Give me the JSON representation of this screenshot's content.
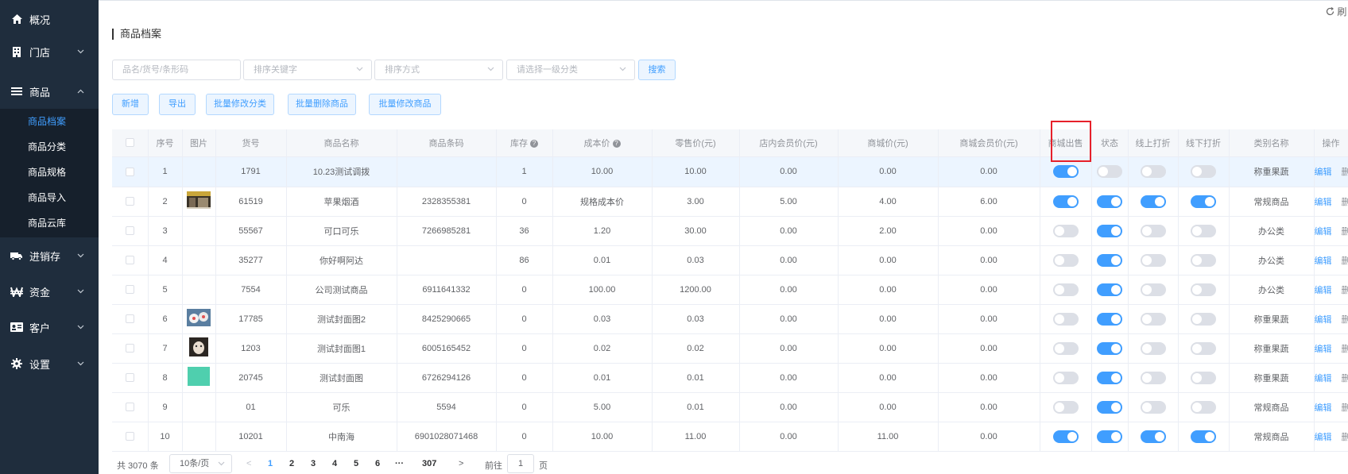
{
  "sidebar": {
    "items": [
      {
        "label": "概况",
        "icon": "home-icon"
      },
      {
        "label": "门店",
        "icon": "store-icon"
      },
      {
        "label": "商品",
        "icon": "list-icon"
      },
      {
        "label": "进销存",
        "icon": "truck-icon"
      },
      {
        "label": "资金",
        "icon": "currency-icon"
      },
      {
        "label": "客户",
        "icon": "id-card-icon"
      },
      {
        "label": "设置",
        "icon": "gear-icon"
      }
    ],
    "sub_items": [
      "商品档案",
      "商品分类",
      "商品规格",
      "商品导入",
      "商品云库"
    ]
  },
  "header": {
    "refresh_label": "刷"
  },
  "page_title": "商品档案",
  "filters": {
    "keyword_placeholder": "品名/货号/条形码",
    "sort_key_placeholder": "排序关键字",
    "sort_order_placeholder": "排序方式",
    "category_placeholder": "请选择一级分类",
    "search_label": "搜索"
  },
  "toolbar": {
    "add": "新增",
    "export": "导出",
    "batch_category": "批量修改分类",
    "batch_delete": "批量删除商品",
    "batch_edit": "批量修改商品"
  },
  "table": {
    "headers": {
      "index": "序号",
      "image": "图片",
      "code": "货号",
      "name": "商品名称",
      "barcode": "商品条码",
      "stock": "库存",
      "cost": "成本价",
      "retail": "零售价(元)",
      "member": "店内会员价(元)",
      "mall": "商城价(元)",
      "mall_member": "商城会员价(元)",
      "mall_sale": "商城出售",
      "status": "状态",
      "online_discount": "线上打折",
      "offline_discount": "线下打折",
      "category": "类别名称",
      "ops": "操作"
    },
    "help_glyph": "?",
    "edit_label": "编辑",
    "delete_label": "删除",
    "rows": [
      {
        "index": "1",
        "image": "",
        "code": "1791",
        "name": "10.23测试调拨",
        "barcode": "",
        "stock": "1",
        "cost": "10.00",
        "retail": "10.00",
        "member": "0.00",
        "mall": "0.00",
        "mall_member": "0.00",
        "mall_sale": true,
        "status": false,
        "online_discount": false,
        "offline_discount": false,
        "category": "称重果蔬"
      },
      {
        "index": "2",
        "image": "storefront-thumbnail",
        "code": "61519",
        "name": "苹果烟酒",
        "barcode": "2328355381",
        "stock": "0",
        "cost": "规格成本价",
        "retail": "3.00",
        "member": "5.00",
        "mall": "4.00",
        "mall_member": "6.00",
        "mall_sale": true,
        "status": true,
        "online_discount": true,
        "offline_discount": true,
        "category": "常规商品"
      },
      {
        "index": "3",
        "image": "",
        "code": "55567",
        "name": "可口可乐",
        "barcode": "7266985281",
        "stock": "36",
        "cost": "1.20",
        "retail": "30.00",
        "member": "0.00",
        "mall": "2.00",
        "mall_member": "0.00",
        "mall_sale": false,
        "status": true,
        "online_discount": false,
        "offline_discount": false,
        "category": "办公类"
      },
      {
        "index": "4",
        "image": "",
        "code": "35277",
        "name": "你好啊阿达",
        "barcode": "",
        "stock": "86",
        "cost": "0.01",
        "retail": "0.03",
        "member": "0.00",
        "mall": "0.00",
        "mall_member": "0.00",
        "mall_sale": false,
        "status": true,
        "online_discount": false,
        "offline_discount": false,
        "category": "办公类"
      },
      {
        "index": "5",
        "image": "",
        "code": "7554",
        "name": "公司测试商品",
        "barcode": "6911641332",
        "stock": "0",
        "cost": "100.00",
        "retail": "1200.00",
        "member": "0.00",
        "mall": "0.00",
        "mall_member": "0.00",
        "mall_sale": false,
        "status": true,
        "online_discount": false,
        "offline_discount": false,
        "category": "办公类"
      },
      {
        "index": "6",
        "image": "eggs-thumbnail",
        "code": "17785",
        "name": "测试封面图2",
        "barcode": "8425290665",
        "stock": "0",
        "cost": "0.03",
        "retail": "0.03",
        "member": "0.00",
        "mall": "0.00",
        "mall_member": "0.00",
        "mall_sale": false,
        "status": true,
        "online_discount": false,
        "offline_discount": false,
        "category": "称重果蔬"
      },
      {
        "index": "7",
        "image": "pet-thumbnail",
        "code": "1203",
        "name": "测试封面图1",
        "barcode": "6005165452",
        "stock": "0",
        "cost": "0.02",
        "retail": "0.02",
        "member": "0.00",
        "mall": "0.00",
        "mall_member": "0.00",
        "mall_sale": false,
        "status": true,
        "online_discount": false,
        "offline_discount": false,
        "category": "称重果蔬"
      },
      {
        "index": "8",
        "image": "teal-thumbnail",
        "code": "20745",
        "name": "测试封面图",
        "barcode": "6726294126",
        "stock": "0",
        "cost": "0.01",
        "retail": "0.01",
        "member": "0.00",
        "mall": "0.00",
        "mall_member": "0.00",
        "mall_sale": false,
        "status": true,
        "online_discount": false,
        "offline_discount": false,
        "category": "称重果蔬"
      },
      {
        "index": "9",
        "image": "",
        "code": "01",
        "name": "可乐",
        "barcode": "5594",
        "stock": "0",
        "cost": "5.00",
        "retail": "0.01",
        "member": "0.00",
        "mall": "0.00",
        "mall_member": "0.00",
        "mall_sale": false,
        "status": true,
        "online_discount": false,
        "offline_discount": false,
        "category": "常规商品"
      },
      {
        "index": "10",
        "image": "",
        "code": "10201",
        "name": "中南海",
        "barcode": "6901028071468",
        "stock": "0",
        "cost": "10.00",
        "retail": "11.00",
        "member": "0.00",
        "mall": "11.00",
        "mall_member": "0.00",
        "mall_sale": true,
        "status": true,
        "online_discount": true,
        "offline_discount": true,
        "category": "常规商品"
      }
    ]
  },
  "pagination": {
    "total": "共 3070 条",
    "page_size": "10条/页",
    "prev": "<",
    "pages": [
      "1",
      "2",
      "3",
      "4",
      "5",
      "6",
      "···",
      "307"
    ],
    "next": ">",
    "goto_prefix": "前往",
    "goto_value": "1",
    "goto_suffix": "页"
  },
  "colors": {
    "sidebar_bg": "#1f2d3d",
    "accent": "#409eff",
    "highlight_box": "#e6202a"
  }
}
